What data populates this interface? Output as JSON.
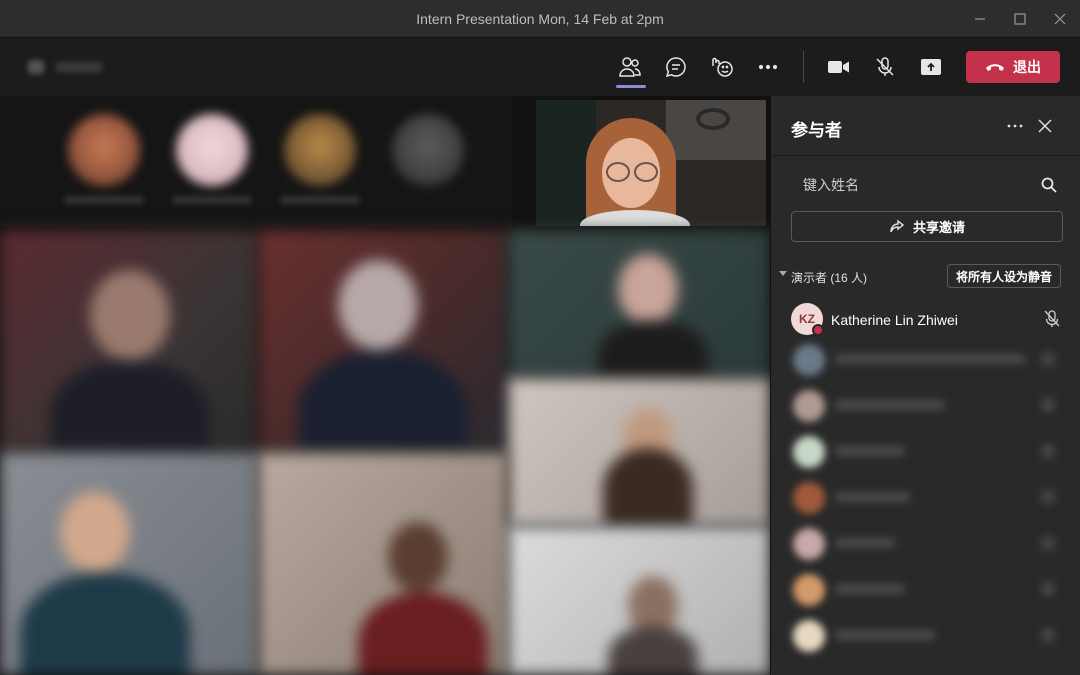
{
  "window": {
    "title": "Intern Presentation Mon, 14 Feb at 2pm"
  },
  "toolbar": {
    "icons": [
      "people-icon",
      "chat-icon",
      "reactions-icon",
      "more-icon",
      "camera-icon",
      "mic-off-icon",
      "share-screen-icon"
    ],
    "leave_label": "退出",
    "leave_color": "#c4314b",
    "active_tab": "people"
  },
  "panel": {
    "title": "参与者",
    "search_placeholder": "键入姓名",
    "share_invite_label": "共享邀请",
    "presenters_section_label": "演示者 (16 人)",
    "mute_all_label": "将所有人设为静音",
    "first_participant": {
      "initials": "KZ",
      "name": "Katherine Lin Zhiwei",
      "muted": true
    }
  },
  "colors": {
    "accent": "#8d8ddb",
    "leave": "#c4314b",
    "panel_bg": "#292929",
    "stage_bg": "#111111"
  }
}
